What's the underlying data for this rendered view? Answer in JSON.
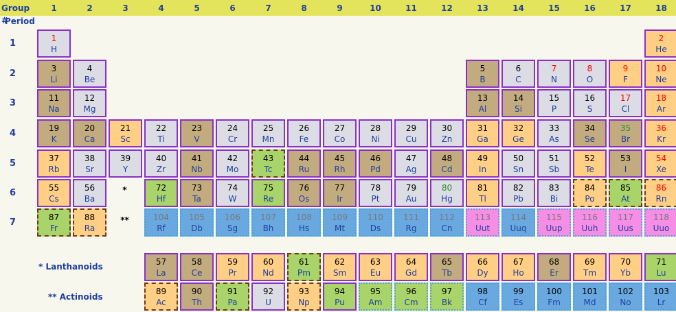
{
  "header": {
    "group_label": "Group #",
    "period_label": "Period",
    "groups": [
      "1",
      "2",
      "3",
      "4",
      "5",
      "6",
      "7",
      "8",
      "9",
      "10",
      "11",
      "12",
      "13",
      "14",
      "15",
      "16",
      "17",
      "18"
    ]
  },
  "periods": [
    "1",
    "2",
    "3",
    "4",
    "5",
    "6",
    "7"
  ],
  "markers": {
    "lanthanoid": "*",
    "actinoid": "**"
  },
  "series_labels": {
    "lanthanoids": "* Lanthanoids",
    "actinoids": "** Actinoids"
  },
  "colors": {
    "grey": "#dcdce4",
    "tan": "#c2ab7e",
    "orange": "#ffcf86",
    "green": "#a8d46a",
    "blue": "#6aa9e0",
    "pink": "#f78ee6",
    "red": "#ff0000",
    "darkgreen": "#2e8b2e",
    "black": "#000000",
    "graytext": "#777777"
  },
  "elements": [
    [
      "1",
      "H",
      1,
      1,
      "grey",
      "red",
      ""
    ],
    [
      "2",
      "He",
      18,
      1,
      "orange",
      "red",
      ""
    ],
    [
      "3",
      "Li",
      1,
      2,
      "tan",
      "black",
      ""
    ],
    [
      "4",
      "Be",
      2,
      2,
      "grey",
      "black",
      ""
    ],
    [
      "5",
      "B",
      13,
      2,
      "tan",
      "black",
      ""
    ],
    [
      "6",
      "C",
      14,
      2,
      "grey",
      "black",
      ""
    ],
    [
      "7",
      "N",
      15,
      2,
      "grey",
      "red",
      ""
    ],
    [
      "8",
      "O",
      16,
      2,
      "grey",
      "red",
      ""
    ],
    [
      "9",
      "F",
      17,
      2,
      "orange",
      "red",
      ""
    ],
    [
      "10",
      "Ne",
      18,
      2,
      "orange",
      "red",
      ""
    ],
    [
      "11",
      "Na",
      1,
      3,
      "tan",
      "black",
      ""
    ],
    [
      "12",
      "Mg",
      2,
      3,
      "grey",
      "black",
      ""
    ],
    [
      "13",
      "Al",
      13,
      3,
      "tan",
      "black",
      ""
    ],
    [
      "14",
      "Si",
      14,
      3,
      "tan",
      "black",
      ""
    ],
    [
      "15",
      "P",
      15,
      3,
      "grey",
      "black",
      ""
    ],
    [
      "16",
      "S",
      16,
      3,
      "grey",
      "black",
      ""
    ],
    [
      "17",
      "Cl",
      17,
      3,
      "grey",
      "red",
      ""
    ],
    [
      "18",
      "Ar",
      18,
      3,
      "orange",
      "red",
      ""
    ],
    [
      "19",
      "K",
      1,
      4,
      "tan",
      "black",
      ""
    ],
    [
      "20",
      "Ca",
      2,
      4,
      "tan",
      "black",
      ""
    ],
    [
      "21",
      "Sc",
      3,
      4,
      "orange",
      "black",
      ""
    ],
    [
      "22",
      "Ti",
      4,
      4,
      "grey",
      "black",
      ""
    ],
    [
      "23",
      "V",
      5,
      4,
      "tan",
      "black",
      ""
    ],
    [
      "24",
      "Cr",
      6,
      4,
      "grey",
      "black",
      ""
    ],
    [
      "25",
      "Mn",
      7,
      4,
      "grey",
      "black",
      ""
    ],
    [
      "26",
      "Fe",
      8,
      4,
      "grey",
      "black",
      ""
    ],
    [
      "27",
      "Co",
      9,
      4,
      "grey",
      "black",
      ""
    ],
    [
      "28",
      "Ni",
      10,
      4,
      "grey",
      "black",
      ""
    ],
    [
      "29",
      "Cu",
      11,
      4,
      "grey",
      "black",
      ""
    ],
    [
      "30",
      "Zn",
      12,
      4,
      "grey",
      "black",
      ""
    ],
    [
      "31",
      "Ga",
      13,
      4,
      "orange",
      "black",
      ""
    ],
    [
      "32",
      "Ge",
      14,
      4,
      "orange",
      "black",
      ""
    ],
    [
      "33",
      "As",
      15,
      4,
      "grey",
      "black",
      ""
    ],
    [
      "34",
      "Se",
      16,
      4,
      "tan",
      "black",
      ""
    ],
    [
      "35",
      "Br",
      17,
      4,
      "tan",
      "darkgreen",
      ""
    ],
    [
      "36",
      "Kr",
      18,
      4,
      "orange",
      "red",
      ""
    ],
    [
      "37",
      "Rb",
      1,
      5,
      "orange",
      "black",
      ""
    ],
    [
      "38",
      "Sr",
      2,
      5,
      "grey",
      "black",
      ""
    ],
    [
      "39",
      "Y",
      3,
      5,
      "grey",
      "black",
      ""
    ],
    [
      "40",
      "Zr",
      4,
      5,
      "grey",
      "black",
      ""
    ],
    [
      "41",
      "Nb",
      5,
      5,
      "tan",
      "black",
      ""
    ],
    [
      "42",
      "Mo",
      6,
      5,
      "grey",
      "black",
      ""
    ],
    [
      "43",
      "Tc",
      7,
      5,
      "green",
      "black",
      "dashed"
    ],
    [
      "44",
      "Ru",
      8,
      5,
      "tan",
      "black",
      ""
    ],
    [
      "45",
      "Rh",
      9,
      5,
      "tan",
      "black",
      ""
    ],
    [
      "46",
      "Pd",
      10,
      5,
      "tan",
      "black",
      ""
    ],
    [
      "47",
      "Ag",
      11,
      5,
      "grey",
      "black",
      ""
    ],
    [
      "48",
      "Cd",
      12,
      5,
      "tan",
      "black",
      ""
    ],
    [
      "49",
      "In",
      13,
      5,
      "orange",
      "black",
      ""
    ],
    [
      "50",
      "Sn",
      14,
      5,
      "grey",
      "black",
      ""
    ],
    [
      "51",
      "Sb",
      15,
      5,
      "grey",
      "black",
      ""
    ],
    [
      "52",
      "Te",
      16,
      5,
      "orange",
      "black",
      ""
    ],
    [
      "53",
      "I",
      17,
      5,
      "tan",
      "black",
      ""
    ],
    [
      "54",
      "Xe",
      18,
      5,
      "orange",
      "red",
      ""
    ],
    [
      "55",
      "Cs",
      1,
      6,
      "orange",
      "black",
      ""
    ],
    [
      "56",
      "Ba",
      2,
      6,
      "grey",
      "black",
      ""
    ],
    [
      "72",
      "Hf",
      4,
      6,
      "green",
      "black",
      ""
    ],
    [
      "73",
      "Ta",
      5,
      6,
      "tan",
      "black",
      ""
    ],
    [
      "74",
      "W",
      6,
      6,
      "grey",
      "black",
      ""
    ],
    [
      "75",
      "Re",
      7,
      6,
      "green",
      "black",
      ""
    ],
    [
      "76",
      "Os",
      8,
      6,
      "tan",
      "black",
      ""
    ],
    [
      "77",
      "Ir",
      9,
      6,
      "tan",
      "black",
      ""
    ],
    [
      "78",
      "Pt",
      10,
      6,
      "grey",
      "black",
      ""
    ],
    [
      "79",
      "Au",
      11,
      6,
      "grey",
      "black",
      ""
    ],
    [
      "80",
      "Hg",
      12,
      6,
      "grey",
      "darkgreen",
      ""
    ],
    [
      "81",
      "Tl",
      13,
      6,
      "orange",
      "black",
      ""
    ],
    [
      "82",
      "Pb",
      14,
      6,
      "grey",
      "black",
      ""
    ],
    [
      "83",
      "Bi",
      15,
      6,
      "grey",
      "black",
      ""
    ],
    [
      "84",
      "Po",
      16,
      6,
      "orange",
      "black",
      "dashed"
    ],
    [
      "85",
      "At",
      17,
      6,
      "green",
      "black",
      "dashed"
    ],
    [
      "86",
      "Rn",
      18,
      6,
      "orange",
      "red",
      "dashed"
    ],
    [
      "87",
      "Fr",
      1,
      7,
      "green",
      "black",
      "dashed"
    ],
    [
      "88",
      "Ra",
      2,
      7,
      "orange",
      "black",
      "dashed"
    ],
    [
      "104",
      "Rf",
      4,
      7,
      "blue",
      "graytext",
      "dotted"
    ],
    [
      "105",
      "Db",
      5,
      7,
      "blue",
      "graytext",
      "dotted"
    ],
    [
      "106",
      "Sg",
      6,
      7,
      "blue",
      "graytext",
      "dotted"
    ],
    [
      "107",
      "Bh",
      7,
      7,
      "blue",
      "graytext",
      "dotted"
    ],
    [
      "108",
      "Hs",
      8,
      7,
      "blue",
      "graytext",
      "dotted"
    ],
    [
      "109",
      "Mt",
      9,
      7,
      "blue",
      "graytext",
      "dotted"
    ],
    [
      "110",
      "Ds",
      10,
      7,
      "blue",
      "graytext",
      "dotted"
    ],
    [
      "111",
      "Rg",
      11,
      7,
      "blue",
      "graytext",
      "dotted"
    ],
    [
      "112",
      "Cn",
      12,
      7,
      "blue",
      "graytext",
      "dotted"
    ],
    [
      "113",
      "Uut",
      13,
      7,
      "pink",
      "graytext",
      "dotted"
    ],
    [
      "114",
      "Uuq",
      14,
      7,
      "blue",
      "graytext",
      "dotted"
    ],
    [
      "115",
      "Uup",
      15,
      7,
      "pink",
      "graytext",
      "dotted"
    ],
    [
      "116",
      "Uuh",
      16,
      7,
      "pink",
      "graytext",
      "dotted"
    ],
    [
      "117",
      "Uus",
      17,
      7,
      "pink",
      "graytext",
      "dotted"
    ],
    [
      "118",
      "Uuo",
      18,
      7,
      "pink",
      "graytext",
      "dotted"
    ],
    [
      "57",
      "La",
      4,
      "L",
      "tan",
      "black",
      ""
    ],
    [
      "58",
      "Ce",
      5,
      "L",
      "tan",
      "black",
      ""
    ],
    [
      "59",
      "Pr",
      6,
      "L",
      "orange",
      "black",
      ""
    ],
    [
      "60",
      "Nd",
      7,
      "L",
      "orange",
      "black",
      ""
    ],
    [
      "61",
      "Pm",
      8,
      "L",
      "green",
      "black",
      "dashed"
    ],
    [
      "62",
      "Sm",
      9,
      "L",
      "orange",
      "black",
      ""
    ],
    [
      "63",
      "Eu",
      10,
      "L",
      "orange",
      "black",
      ""
    ],
    [
      "64",
      "Gd",
      11,
      "L",
      "orange",
      "black",
      ""
    ],
    [
      "65",
      "Tb",
      12,
      "L",
      "tan",
      "black",
      ""
    ],
    [
      "66",
      "Dy",
      13,
      "L",
      "orange",
      "black",
      ""
    ],
    [
      "67",
      "Ho",
      14,
      "L",
      "orange",
      "black",
      ""
    ],
    [
      "68",
      "Er",
      15,
      "L",
      "tan",
      "black",
      ""
    ],
    [
      "69",
      "Tm",
      16,
      "L",
      "orange",
      "black",
      ""
    ],
    [
      "70",
      "Yb",
      17,
      "L",
      "orange",
      "black",
      ""
    ],
    [
      "71",
      "Lu",
      18,
      "L",
      "green",
      "black",
      ""
    ],
    [
      "89",
      "Ac",
      4,
      "A",
      "orange",
      "black",
      "dashed"
    ],
    [
      "90",
      "Th",
      5,
      "A",
      "tan",
      "black",
      ""
    ],
    [
      "91",
      "Pa",
      6,
      "A",
      "green",
      "black",
      "dashed"
    ],
    [
      "92",
      "U",
      7,
      "A",
      "grey",
      "black",
      ""
    ],
    [
      "93",
      "Np",
      8,
      "A",
      "orange",
      "black",
      "dashed"
    ],
    [
      "94",
      "Pu",
      9,
      "A",
      "green",
      "black",
      ""
    ],
    [
      "95",
      "Am",
      10,
      "A",
      "green",
      "black",
      "dotted"
    ],
    [
      "96",
      "Cm",
      11,
      "A",
      "green",
      "black",
      "dotted"
    ],
    [
      "97",
      "Bk",
      12,
      "A",
      "green",
      "black",
      "dotted"
    ],
    [
      "98",
      "Cf",
      13,
      "A",
      "blue",
      "black",
      "dotted"
    ],
    [
      "99",
      "Es",
      14,
      "A",
      "blue",
      "black",
      "dotted"
    ],
    [
      "100",
      "Fm",
      15,
      "A",
      "blue",
      "black",
      "dotted"
    ],
    [
      "101",
      "Md",
      16,
      "A",
      "blue",
      "black",
      "dotted"
    ],
    [
      "102",
      "No",
      17,
      "A",
      "blue",
      "black",
      "dotted"
    ],
    [
      "103",
      "Lr",
      18,
      "A",
      "blue",
      "black",
      "dotted"
    ]
  ]
}
